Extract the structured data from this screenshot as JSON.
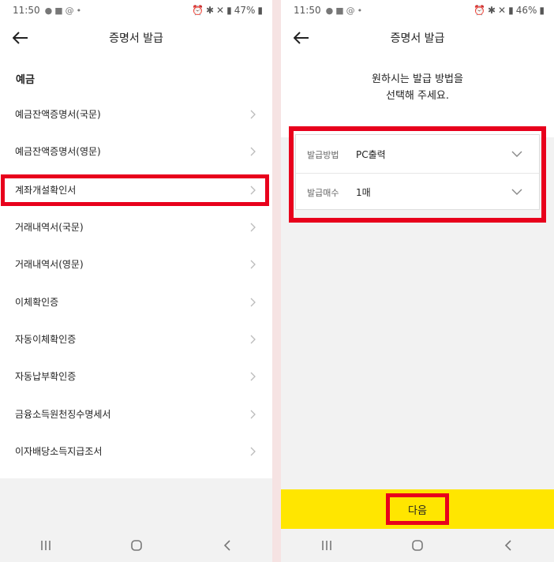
{
  "left": {
    "status": {
      "time": "11:50",
      "battery": "47%"
    },
    "title": "증명서 발급",
    "section": "예금",
    "items": [
      "예금잔액증명서(국문)",
      "예금잔액증명서(영문)",
      "계좌개설확인서",
      "거래내역서(국문)",
      "거래내역서(영문)",
      "이체확인증",
      "자동이체확인증",
      "자동납부확인증",
      "금융소득원천징수명세서",
      "이자배당소득지급조서"
    ]
  },
  "right": {
    "status": {
      "time": "11:50",
      "battery": "46%"
    },
    "title": "증명서 발급",
    "heading_line1": "원하시는 발급 방법을",
    "heading_line2": "선택해 주세요.",
    "method_label": "발급방법",
    "method_value": "PC출력",
    "count_label": "발급매수",
    "count_value": "1매",
    "next_label": "다음"
  },
  "colors": {
    "highlight": "#e8001c",
    "accent_yellow": "#ffe600"
  }
}
